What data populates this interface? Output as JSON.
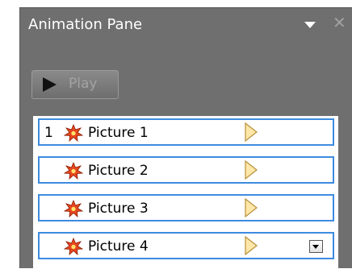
{
  "pane": {
    "title": "Animation Pane",
    "play_label": "Play"
  },
  "list": {
    "items": [
      {
        "number": "1",
        "label": "Picture 1",
        "has_dropdown": false
      },
      {
        "number": "",
        "label": "Picture 2",
        "has_dropdown": false
      },
      {
        "number": "",
        "label": "Picture 3",
        "has_dropdown": false
      },
      {
        "number": "",
        "label": "Picture 4",
        "has_dropdown": true
      }
    ]
  },
  "icons": {
    "pane_menu": "chevron-down-icon",
    "close": "close-icon",
    "play": "play-icon",
    "effect": "entrance-effect-star-icon",
    "timing": "timing-bar-icon",
    "item_menu": "dropdown-arrow-icon"
  },
  "colors": {
    "pane_background": "#6f6f6f",
    "selection_border": "#3d8be0",
    "effect_star": "#e8471f",
    "timing_fill": "#fde7a8"
  }
}
